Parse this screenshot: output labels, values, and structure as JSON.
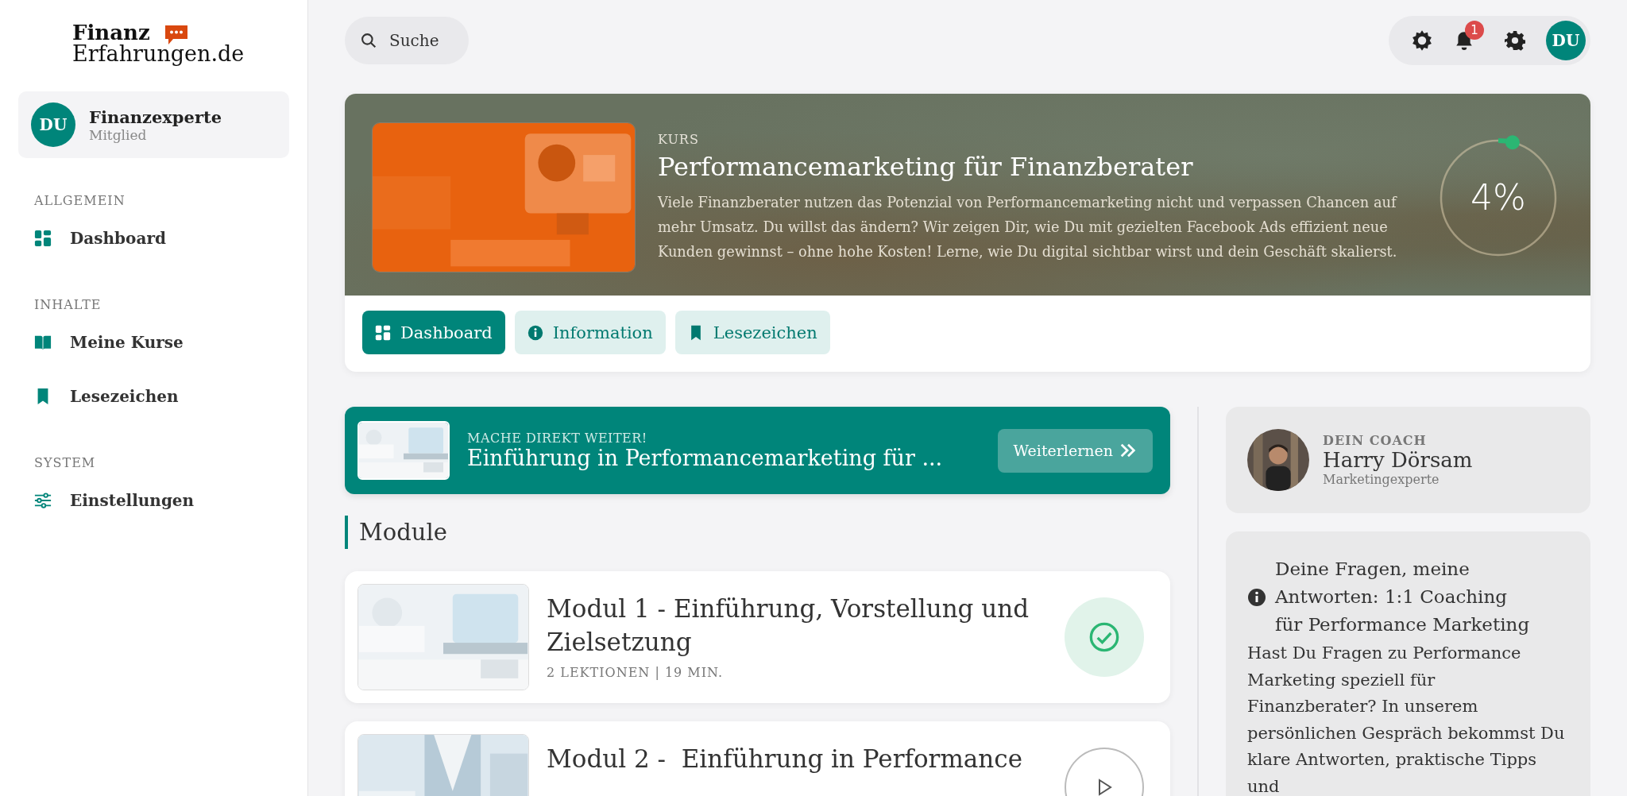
{
  "logo": {
    "line1": "Finanz",
    "line2": "Erfahrungen.de"
  },
  "user": {
    "initials": "DU",
    "name": "Finanzexperte",
    "role": "Mitglied"
  },
  "nav": [
    {
      "heading": "ALLGEMEIN",
      "items": [
        {
          "label": "Dashboard",
          "selected": false
        }
      ]
    },
    {
      "heading": "INHALTE",
      "items": [
        {
          "label": "Meine Kurse",
          "selected": false
        },
        {
          "label": "Lesezeichen",
          "selected": false
        }
      ]
    },
    {
      "heading": "SYSTEM",
      "items": [
        {
          "label": "Einstellungen",
          "selected": false
        }
      ]
    }
  ],
  "search": {
    "placeholder": "Suche"
  },
  "toolbar": {
    "notifications": "1",
    "avatar": "DU"
  },
  "course": {
    "label": "KURS",
    "title": "Performancemarketing für Finanzberater",
    "description": "Viele Finanzberater nutzen das Potenzial von Performancemarketing nicht und verpassen Chancen auf mehr Umsatz. Du willst das ändern? Wir zeigen Dir, wie Du mit gezielten Facebook Ads effizient neue Kunden gewinnst – ohne hohe Kosten! Lerne, wie Du digital sichtbar wirst und dein Geschäft skalierst.",
    "progress": {
      "level": 0.04,
      "reading": "4%"
    }
  },
  "tabs": [
    {
      "label": "Dashboard",
      "selected": true
    },
    {
      "label": "Information",
      "selected": false
    },
    {
      "label": "Lesezeichen",
      "selected": false
    }
  ],
  "continue": {
    "eyebrow": "MACHE DIREKT WEITER!",
    "title": "Einführung in Performancemarketing für ...",
    "button": "Weiterlernen"
  },
  "modules_heading": "Module",
  "modules": [
    {
      "title": "Modul 1 - Einführung, Vorstellung und Zielsetzung",
      "meta": "2 LEKTIONEN | 19 MIN.",
      "completed": true
    },
    {
      "title": "Modul 2 -  Einführung in Performance",
      "completed": false
    }
  ],
  "coach": {
    "label": "DEIN COACH",
    "name": "Harry Dörsam",
    "role": "Marketingexperte"
  },
  "info": {
    "title": "Deine Fragen, meine Antworten: 1:1 Coaching für Performance Marketing",
    "text": "Hast Du Fragen zu Performance Marketing speziell für Finanzberater? In unserem persönlichen Gespräch bekommst Du klare Antworten, praktische Tipps und"
  }
}
